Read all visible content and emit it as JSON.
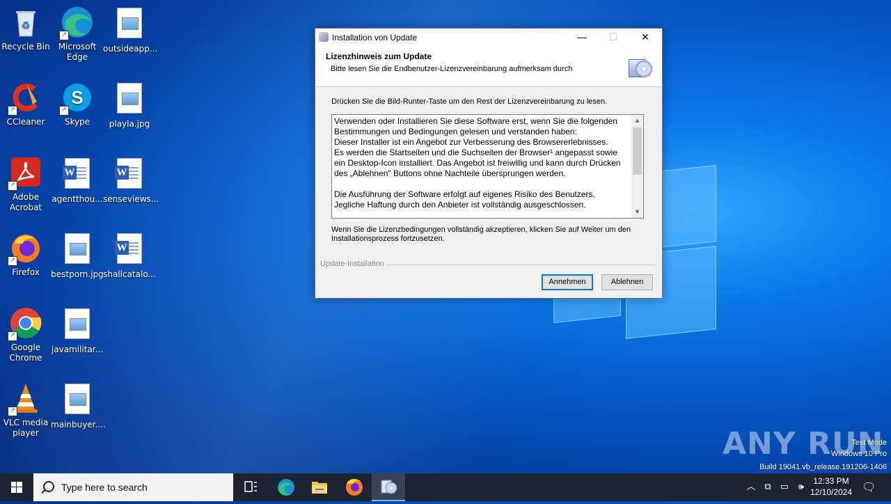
{
  "desktop": {
    "icons": [
      {
        "label": "Recycle Bin"
      },
      {
        "label": "Microsoft Edge"
      },
      {
        "label": "outsideapp..."
      },
      {
        "label": "CCleaner"
      },
      {
        "label": "Skype"
      },
      {
        "label": "playla.jpg"
      },
      {
        "label": "Adobe Acrobat"
      },
      {
        "label": "agentthou..."
      },
      {
        "label": "senseviews..."
      },
      {
        "label": "Firefox"
      },
      {
        "label": "bestporn.jpg"
      },
      {
        "label": "shallcatalo..."
      },
      {
        "label": "Google Chrome"
      },
      {
        "label": "javamilitar..."
      },
      {
        "label": "VLC media player"
      },
      {
        "label": "mainbuyer...."
      }
    ]
  },
  "dialog": {
    "title": "Installation von Update",
    "header_title": "Lizenzhinweis zum Update",
    "header_subtitle": "Bitte lesen Sie die Endbenutzer-Lizenzvereinbarung aufmerksam durch",
    "instruction": "Drücken Sie die Bild-Runter-Taste um den Rest der Lizenzvereinbarung zu lesen.",
    "license_text": "Verwenden oder Installieren Sie diese Software erst, wenn Sie die folgenden\nBestimmungen und Bedingungen gelesen und verstanden haben:\nDieser Installer ist ein Angebot zur Verbesserung des Browsererlebnisses.\nEs werden die Startseiten und die Suchseiten der Browser¹ angepasst sowie\nein Desktop-Icon installiert. Das Angebot ist freiwillig und kann durch Drücken\ndes „Ablehnen\" Buttons ohne Nachteile übersprungen werden.\n\nDie Ausführung der Software erfolgt auf eigenes Risiko des Benutzers.\nJegliche Haftung durch den Anbieter ist vollständig ausgeschlossen.",
    "accept_note": "Wenn Sie die Lizenzbedingungen vollständig akzeptieren, klicken Sie auf Weiter um den Installationsprozess fortzusetzen.",
    "group_label": "Update-Installation",
    "accept_button": "Annehmen",
    "decline_button": "Ablehnen",
    "minimize": "—",
    "maximize": "☐",
    "close": "✕"
  },
  "watermark": {
    "brand": "ANY RUN",
    "line1": "Test Mode",
    "line2": "Windows 10 Pro",
    "line3": "Build 19041.vb_release.191206-1406"
  },
  "taskbar": {
    "search_placeholder": "Type here to search",
    "time": "12:33 PM",
    "date": "12/10/2024",
    "icons": [
      "windows-start-icon",
      "search-icon",
      "task-view-icon",
      "edge-icon",
      "file-explorer-icon",
      "firefox-icon",
      "installer-icon",
      "chevron-up-icon",
      "network-icon",
      "volume-icon",
      "notification-icon"
    ]
  },
  "colors": {
    "accent": "#0078d7",
    "taskbar": "#1b2330"
  }
}
